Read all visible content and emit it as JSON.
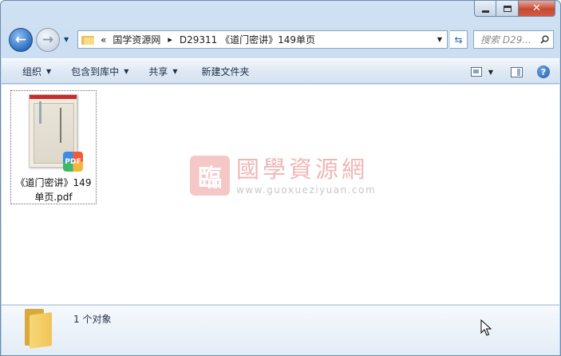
{
  "window": {
    "caption": {
      "minimize_icon": "minimize-icon",
      "maximize_icon": "maximize-icon",
      "close_icon": "close-icon",
      "close_glyph": "✕"
    }
  },
  "nav": {
    "back_glyph": "←",
    "forward_glyph": "→",
    "breadcrumb_chevron": "«",
    "breadcrumb": [
      "国学资源网",
      "D29311 《道门密讲》149单页"
    ],
    "separator_glyph": "▸",
    "dropdown_glyph": "▼",
    "refresh_glyph": "⇆",
    "search_placeholder": "搜索 D29..."
  },
  "toolbar": {
    "organize": "组织",
    "include_in_library": "包含到库中",
    "share": "共享",
    "new_folder": "新建文件夹",
    "arrow_glyph": "▼",
    "help_glyph": "?"
  },
  "watermark": {
    "seal_char": "臨",
    "title": "國學資源網",
    "url": "www.guoxueziyuan.com",
    "color": "#f0b6b6"
  },
  "files": [
    {
      "name": "《道门密讲》149单页.pdf",
      "badge": "PDF",
      "type_icon": "pdf-icon"
    }
  ],
  "details": {
    "count_text": "1 个对象"
  },
  "colors": {
    "accent": "#2f6fbf",
    "toolbar_bg": "#dfe9f5",
    "close_red": "#c74a33"
  }
}
